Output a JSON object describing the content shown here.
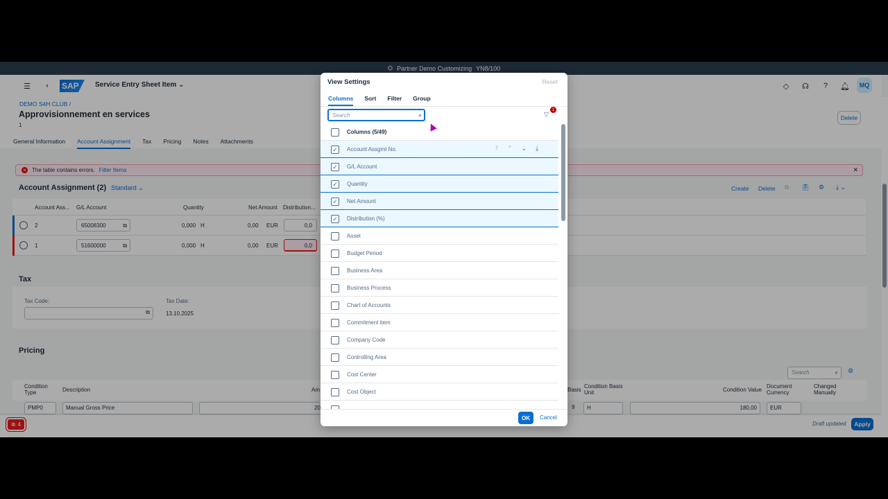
{
  "system_bar": {
    "title": "Partner Demo Customizing",
    "client": "YN8/100"
  },
  "shell": {
    "app_title": "Service Entry Sheet Item",
    "logo": "SAP",
    "avatar": "MQ"
  },
  "header": {
    "breadcrumb": "DEMO S4H CLUB /",
    "title": "Approvisionnement en services",
    "subtitle": "1",
    "delete_label": "Delete",
    "tabs": [
      "General Information",
      "Account Assignment",
      "Tax",
      "Pricing",
      "Notes",
      "Attachments"
    ],
    "active_tab": "Account Assignment"
  },
  "error_strip": {
    "message": "The table contains errors.",
    "link": "Filter Items"
  },
  "account_assignment": {
    "title": "Account Assignment (2)",
    "variant": "Standard",
    "actions": {
      "create": "Create",
      "delete": "Delete"
    },
    "columns": [
      "Account Ass...",
      "G/L Account",
      "Quantity",
      "Net Amount",
      "Distribution..."
    ],
    "rows": [
      {
        "no": "2",
        "gl": "65008300",
        "qty": "0,000",
        "unit": "H",
        "amount": "0,00",
        "currency": "EUR",
        "dist": "0,0",
        "status": "info"
      },
      {
        "no": "1",
        "gl": "51600000",
        "qty": "0,000",
        "unit": "H",
        "amount": "0,00",
        "currency": "EUR",
        "dist": "0,0",
        "status": "error"
      }
    ]
  },
  "tax": {
    "title": "Tax",
    "tax_code_label": "Tax Code:",
    "tax_date_label": "Tax Date:",
    "tax_date": "13.10.2025"
  },
  "pricing": {
    "title": "Pricing",
    "search_placeholder": "Search",
    "columns": {
      "condition_type": "Condition Type",
      "description": "Description",
      "amount_trunc": "Am",
      "basis_trunc": "Basis",
      "basis_unit": "Condition Basis Unit",
      "condition_value": "Condition Value",
      "doc_currency": "Document Currency",
      "changed": "Changed Manually"
    },
    "row": {
      "type": "PMP0",
      "description": "Manual Gross Price",
      "amount_trunc": "20",
      "basis_trunc": "9",
      "unit": "H",
      "value": "180,00",
      "currency": "EUR"
    }
  },
  "footer": {
    "error_count": "4",
    "draft_status": "Draft updated",
    "apply_label": "Apply"
  },
  "dialog": {
    "title": "View Settings",
    "reset_label": "Reset",
    "tabs": [
      "Columns",
      "Sort",
      "Filter",
      "Group"
    ],
    "active_tab": "Columns",
    "search_placeholder": "Search",
    "filter_badge": "1",
    "header_label": "Columns (5/49)",
    "items": [
      {
        "label": "Account Assgmt No.",
        "checked": true
      },
      {
        "label": "G/L Account",
        "checked": true
      },
      {
        "label": "Quantity",
        "checked": true
      },
      {
        "label": "Net Amount",
        "checked": true
      },
      {
        "label": "Distribution (%)",
        "checked": true
      },
      {
        "label": "Asset",
        "checked": false
      },
      {
        "label": "Budget Period",
        "checked": false
      },
      {
        "label": "Business Area",
        "checked": false
      },
      {
        "label": "Business Process",
        "checked": false
      },
      {
        "label": "Chart of Accounts",
        "checked": false
      },
      {
        "label": "Commitment item",
        "checked": false
      },
      {
        "label": "Company Code",
        "checked": false
      },
      {
        "label": "Controlling Area",
        "checked": false
      },
      {
        "label": "Cost Center",
        "checked": false
      },
      {
        "label": "Cost Object",
        "checked": false
      }
    ],
    "ok_label": "OK",
    "cancel_label": "Cancel"
  },
  "colors": {
    "accent": "#0a6ed1",
    "error": "#ee1a1a",
    "shell_bar": "#2c3e50"
  }
}
